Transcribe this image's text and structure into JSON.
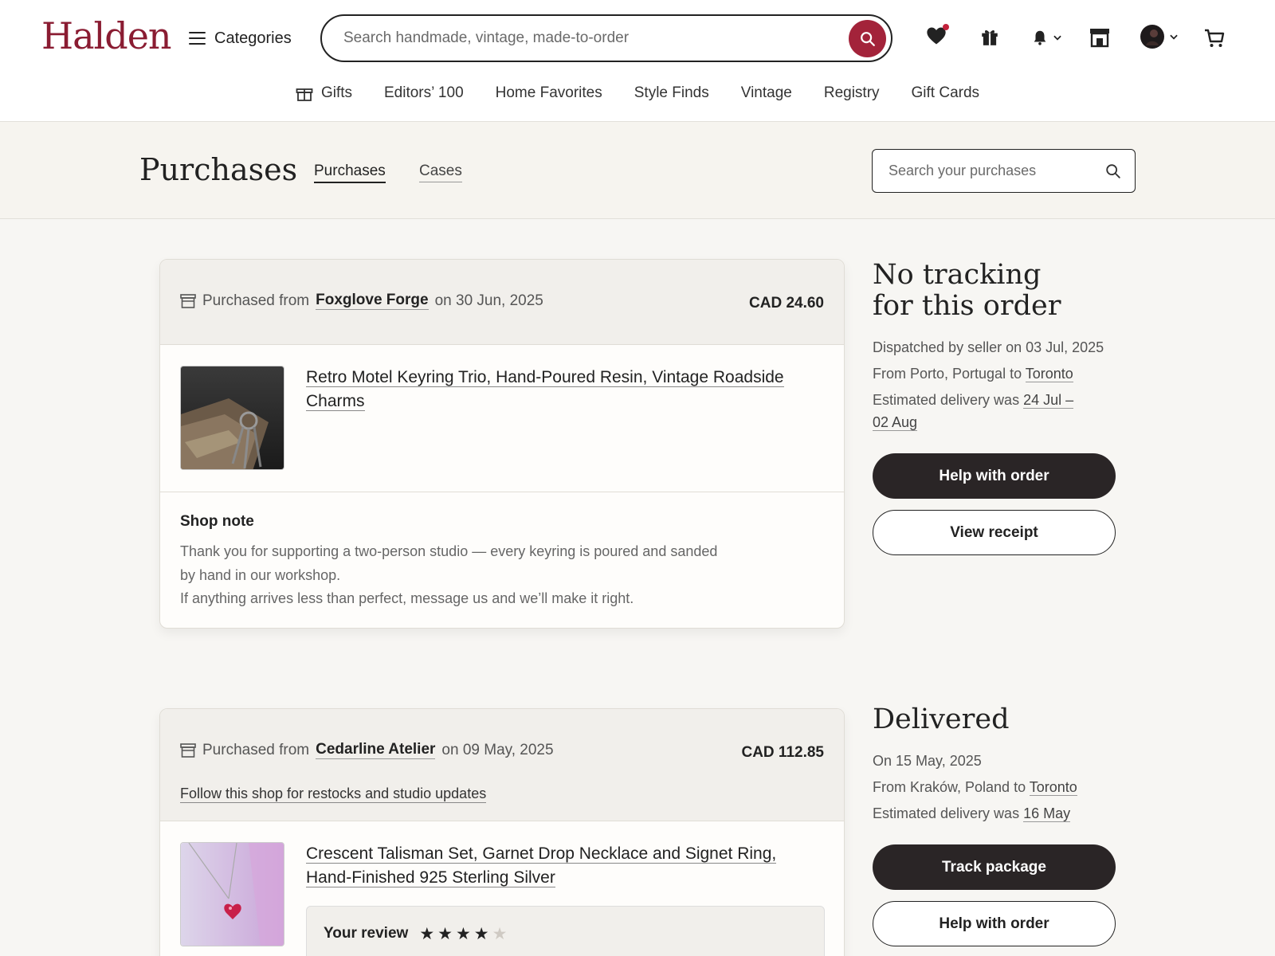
{
  "header": {
    "logo": "Halden",
    "categories_label": "Categories",
    "search_placeholder": "Search handmade, vintage, made-to-order"
  },
  "nav": {
    "items": [
      "Gifts",
      "Editors’ 100",
      "Home Favorites",
      "Style Finds",
      "Vintage",
      "Registry",
      "Gift Cards"
    ]
  },
  "purchases_header": {
    "title": "Purchases",
    "tabs": [
      "Purchases",
      "Cases"
    ],
    "search_placeholder": "Search your purchases"
  },
  "orders": [
    {
      "purchased_from_label": "Purchased from",
      "shop": "Foxglove Forge",
      "date": "on 30 Jun, 2025",
      "price": "CAD 24.60",
      "item_title": "Retro Motel Keyring Trio, Hand-Poured Resin, Vintage Roadside Charms",
      "note_title": "Shop note",
      "note_lines": [
        "Thank you for supporting a two-person studio — every keyring is poured and sanded",
        "by hand in our workshop.",
        "If anything arrives less than perfect, message us and we’ll make it right."
      ],
      "status": {
        "title_line1": "No tracking",
        "title_line2": "for this order",
        "dispatched": "Dispatched by seller on 03 Jul, 2025",
        "from_prefix": "From Porto, Portugal to ",
        "to": "Toronto",
        "estimated_prefix": "Estimated delivery was ",
        "estimated_part1": "24 Jul –",
        "estimated_part2": "02 Aug",
        "button1": "Help with order",
        "button2": "View receipt"
      }
    },
    {
      "purchased_from_label": "Purchased from",
      "shop": "Cedarline Atelier",
      "date": "on 09 May, 2025",
      "price": "CAD 112.85",
      "follow_link": "Follow this shop for restocks and studio updates",
      "item_title": "Crescent Talisman Set, Garnet Drop Necklace and Signet Ring, Hand-Finished 925 Sterling Silver",
      "review_label": "Your review",
      "rating": 4,
      "rating_max": 5,
      "status": {
        "title": "Delivered",
        "on": "On 15 May, 2025",
        "from_prefix": "From Kraków, Poland to ",
        "to": "Toronto",
        "estimated_prefix": "Estimated delivery was ",
        "estimated": "16 May",
        "button1": "Track package",
        "button2": "Help with order"
      }
    }
  ],
  "colors": {
    "brand": "#8a1c32",
    "search_button": "#a3233a",
    "dark_button": "#2a2526",
    "notification_dot": "#c2213b"
  },
  "icons": [
    "menu-icon",
    "search-icon",
    "heart-icon",
    "gift-icon",
    "bell-icon",
    "shop-icon",
    "avatar",
    "cart-icon",
    "store-icon",
    "star-icon"
  ]
}
